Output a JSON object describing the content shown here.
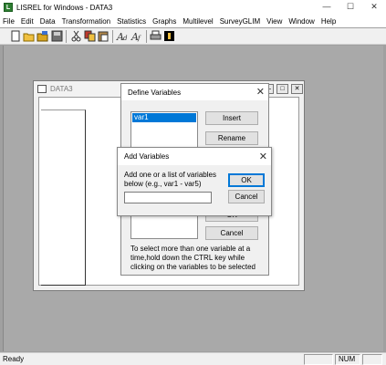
{
  "app": {
    "title": "LISREL for Windows - DATA3",
    "icon_letter": "L",
    "window_buttons": {
      "minimize": "—",
      "maximize": "☐",
      "close": "✕"
    }
  },
  "menu": [
    "File",
    "Edit",
    "Data",
    "Transformation",
    "Statistics",
    "Graphs",
    "Multilevel",
    "SurveyGLIM",
    "View",
    "Window",
    "Help"
  ],
  "toolbar": {
    "icons": [
      "new-file-icon",
      "open-folder-icon",
      "open-icon",
      "save-icon",
      "cut-icon",
      "copy-icon",
      "paste-icon",
      "italic-a-icon",
      "italic-a-alt-icon",
      "print-icon",
      "help-icon"
    ]
  },
  "data_window": {
    "title": "DATA3",
    "buttons": {
      "minimize": "—",
      "maximize": "□",
      "close": "✕"
    }
  },
  "define_variables": {
    "title": "Define Variables",
    "list_items": [
      "var1"
    ],
    "buttons": {
      "insert": "Insert",
      "rename": "Rename",
      "ok": "OK",
      "cancel": "Cancel"
    },
    "hint": "To select more than one variable at a time,hold down the CTRL key while clicking on the variables to be selected"
  },
  "add_variables": {
    "title": "Add Variables",
    "prompt": "Add one or a list of variables below (e.g., var1 - var5)",
    "input_value": "",
    "buttons": {
      "ok": "OK",
      "cancel": "Cancel"
    }
  },
  "status": {
    "left": "Ready",
    "num": "NUM"
  }
}
